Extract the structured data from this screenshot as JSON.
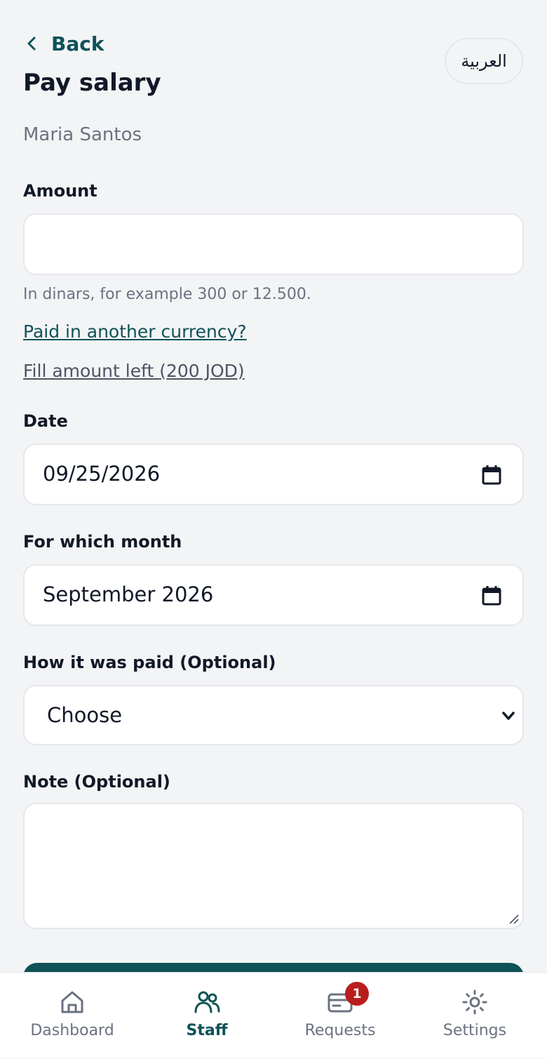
{
  "header": {
    "back_label": "Back",
    "language_label": "العربية",
    "title": "Pay salary",
    "employee_name": "Maria Santos"
  },
  "form": {
    "amount": {
      "label": "Amount",
      "value": "",
      "hint": "In dinars, for example 300 or 12.500."
    },
    "currency_link": "Paid in another currency?",
    "fill_amount_link": "Fill amount left (200 JOD)",
    "date": {
      "label": "Date",
      "value": "09/25/2026"
    },
    "month": {
      "label": "For which month",
      "value": "September 2026"
    },
    "payment_method": {
      "label": "How it was paid (Optional)",
      "selected": "Choose"
    },
    "note": {
      "label": "Note (Optional)",
      "value": ""
    }
  },
  "nav": {
    "items": [
      {
        "label": "Dashboard",
        "icon": "home-icon",
        "active": false
      },
      {
        "label": "Staff",
        "icon": "staff-icon",
        "active": true
      },
      {
        "label": "Requests",
        "icon": "requests-icon",
        "active": false,
        "badge": "1"
      },
      {
        "label": "Settings",
        "icon": "settings-icon",
        "active": false
      }
    ]
  },
  "colors": {
    "accent": "#0f5257",
    "background": "#f3f4f6",
    "badge": "#b91c1c",
    "muted_text": "#6b7280"
  }
}
